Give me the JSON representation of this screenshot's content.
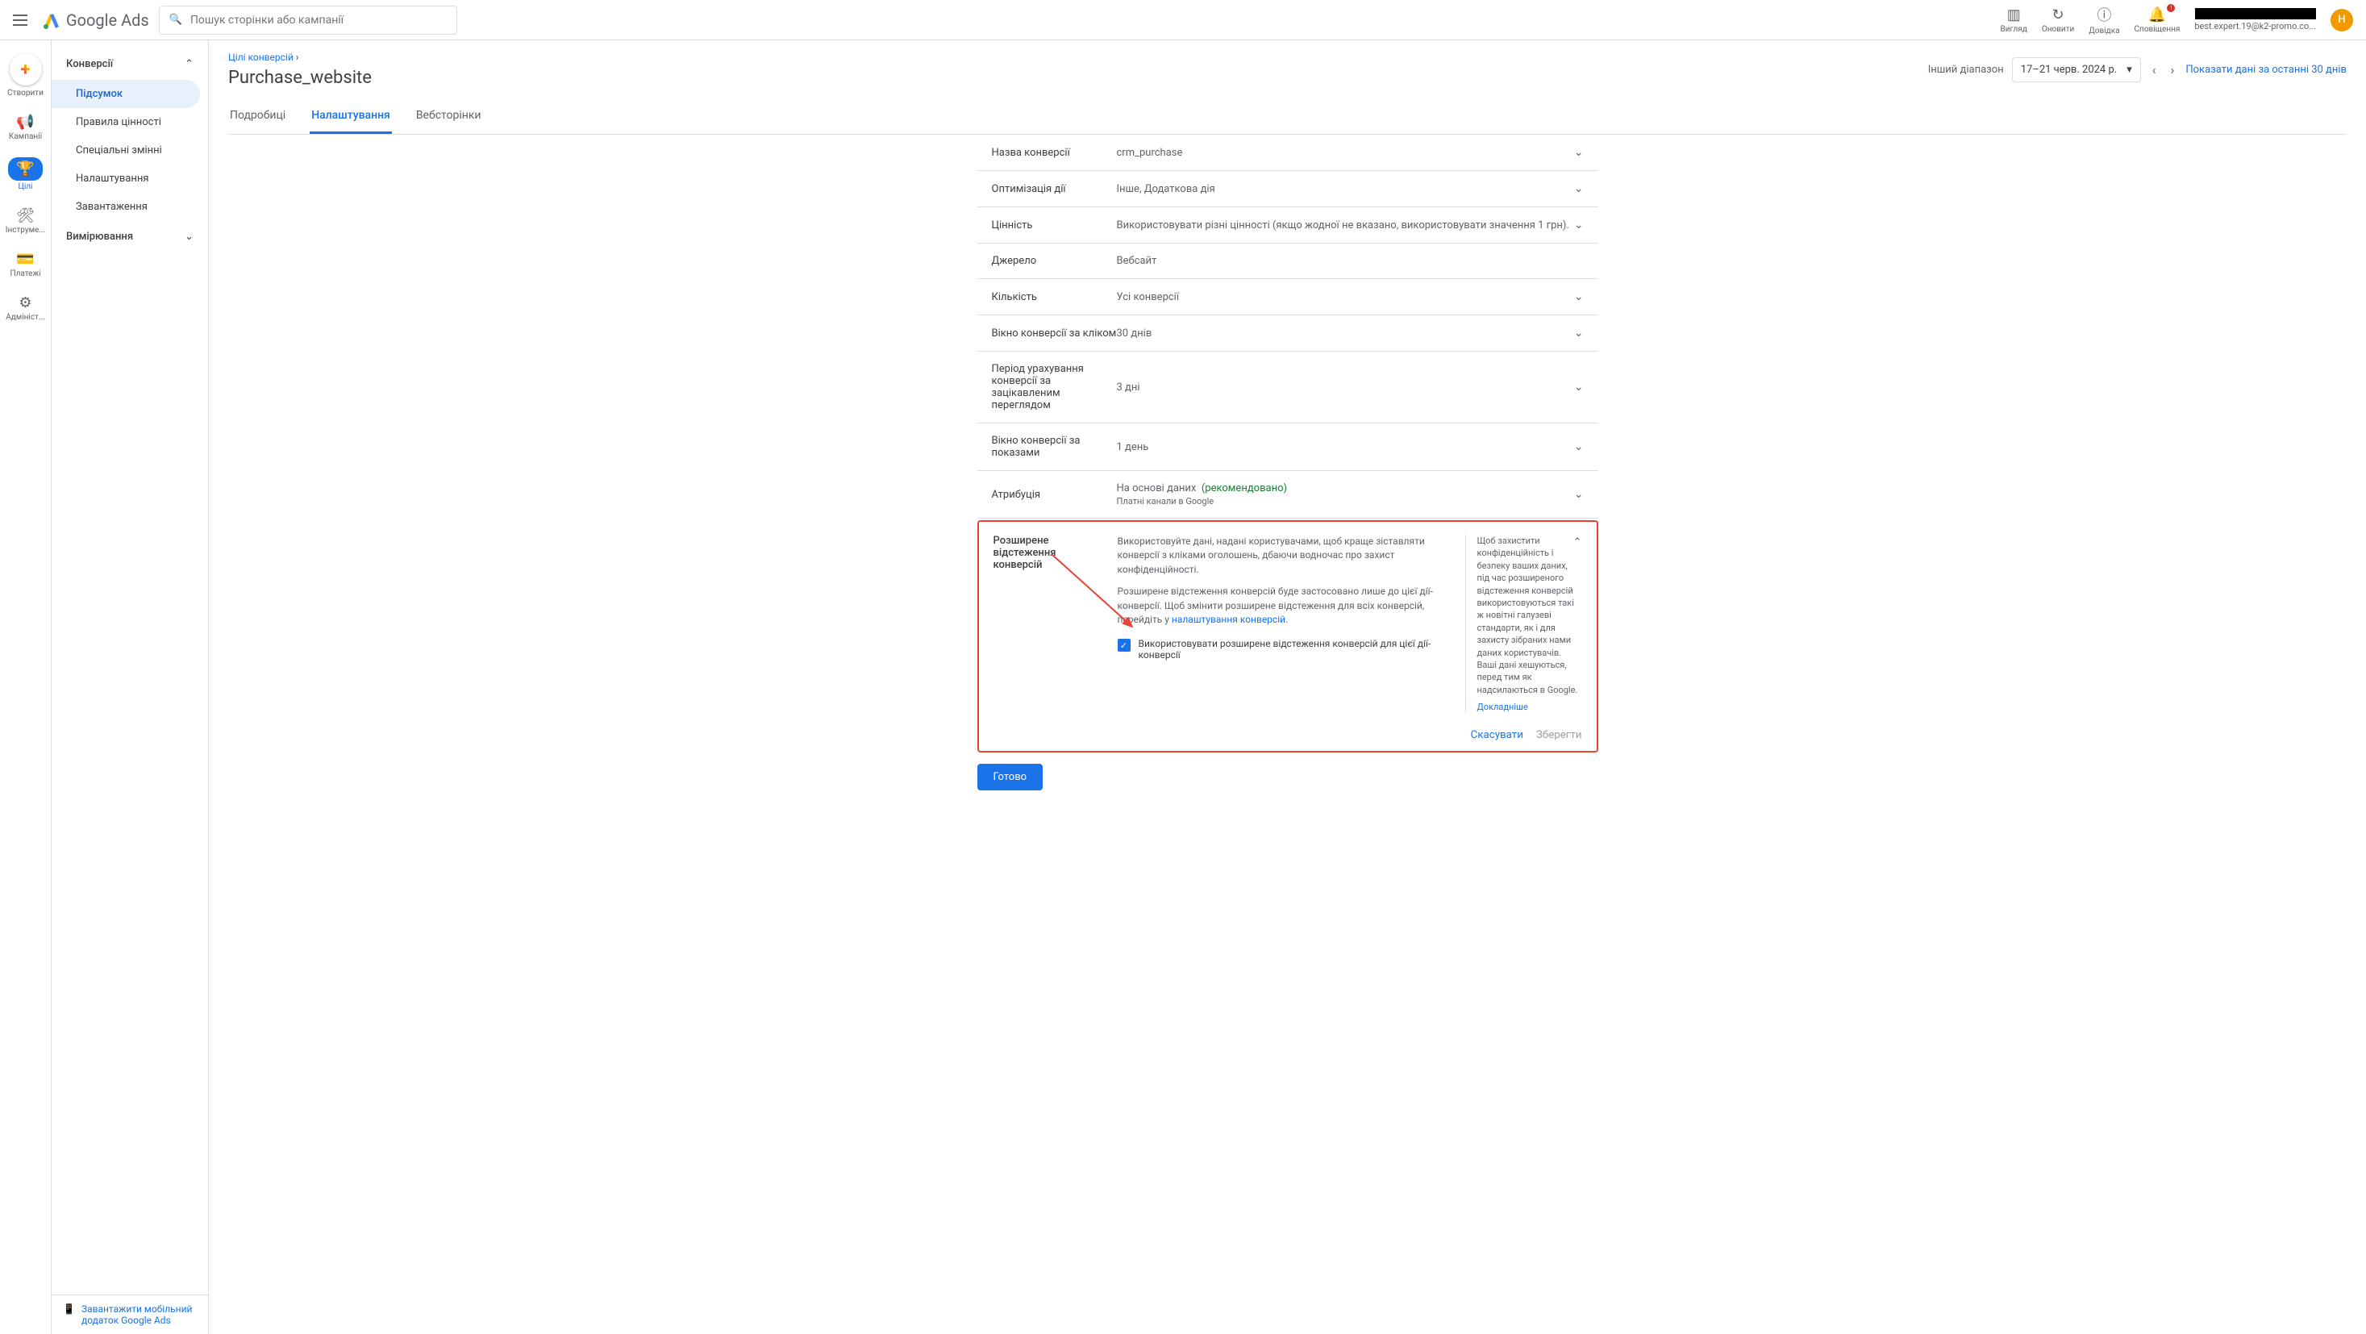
{
  "topbar": {
    "brand": "Google Ads",
    "search_placeholder": "Пошук сторінки або кампанії",
    "actions": {
      "view": "Вигляд",
      "refresh": "Оновити",
      "help": "Довідка",
      "notifications": "Сповіщення"
    },
    "account_email": "best.expert.19@k2-promo.co...",
    "avatar_initial": "H"
  },
  "leftrail": {
    "create": "Створити",
    "items": [
      {
        "label": "Кампанії"
      },
      {
        "label": "Цілі"
      },
      {
        "label": "Інструме..."
      },
      {
        "label": "Платежі"
      },
      {
        "label": "Адмініст..."
      }
    ]
  },
  "sidenav": {
    "section_conversions": "Конверсії",
    "items": [
      {
        "label": "Підсумок"
      },
      {
        "label": "Правила цінності"
      },
      {
        "label": "Спеціальні змінні"
      },
      {
        "label": "Налаштування"
      },
      {
        "label": "Завантаження"
      }
    ],
    "section_measure": "Вимірювання",
    "download_app": "Завантажити мобільний додаток Google Ads"
  },
  "header": {
    "breadcrumb_root": "Цілі конверсій",
    "page_title": "Purchase_website",
    "date_label": "Інший діапазон",
    "date_range": "17–21 черв. 2024 р.",
    "last_30": "Показати дані за останні 30 днів"
  },
  "tabs": {
    "details": "Подробиці",
    "settings": "Налаштування",
    "webpages": "Вебсторінки"
  },
  "settings": [
    {
      "label": "Назва конверсії",
      "value": "crm_purchase"
    },
    {
      "label": "Оптимізація дії",
      "value": "Інше, Додаткова дія"
    },
    {
      "label": "Цінність",
      "value": "Використовувати різні цінності (якщо жодної не вказано, використовувати значення 1 грн)."
    },
    {
      "label": "Джерело",
      "value": "Вебсайт",
      "no_chev": true
    },
    {
      "label": "Кількість",
      "value": "Усі конверсії"
    },
    {
      "label": "Вікно конверсії за кліком",
      "value": "30 днів"
    },
    {
      "label": "Період урахування конверсії за зацікавленим переглядом",
      "value": "3 дні"
    },
    {
      "label": "Вікно конверсії за показами",
      "value": "1 день"
    }
  ],
  "attribution": {
    "label": "Атрибуція",
    "value": "На основі даних",
    "recommended": "(рекомендовано)",
    "sub": "Платні канали в Google"
  },
  "enhanced": {
    "label": "Розширене відстеження конверсій",
    "desc1": "Використовуйте дані, надані користувачами, щоб краще зіставляти конверсії з кліками оголошень, дбаючи водночас про захист конфіденційності.",
    "desc2_a": "Розширене відстеження конверсій буде застосовано лише до цієї дії-конверсії. Щоб змінити розширене відстеження для всіх конверсій, перейдіть у ",
    "desc2_link": "налаштування конверсій",
    "checkbox_label": "Використовувати розширене відстеження конверсій для цієї дії-конверсії",
    "side_text": "Щоб захистити конфіденційність і безпеку ваших даних, під час розширеного відстеження конверсій використовуються такі ж новітні галузеві стандарти, як і для захисту зібраних нами даних користувачів. Ваші дані хешуються, перед тим як надсилаються в Google.",
    "side_link": "Докладніше",
    "cancel": "Скасувати",
    "save": "Зберегти"
  },
  "done": "Готово"
}
